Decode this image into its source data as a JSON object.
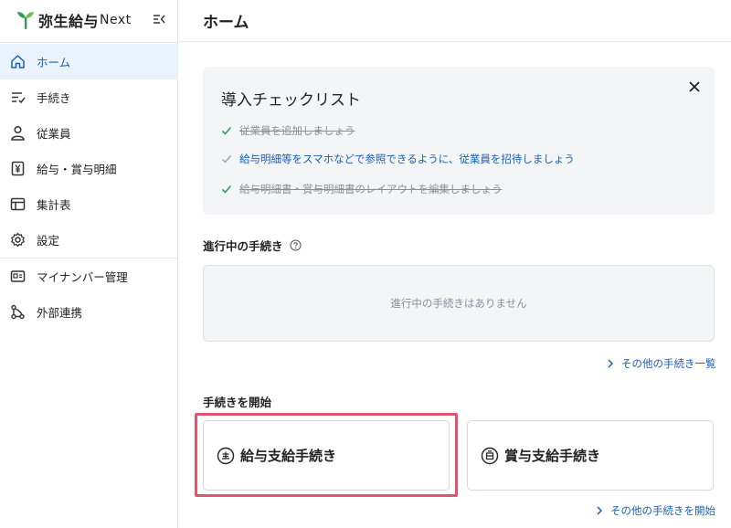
{
  "brand": {
    "name": "弥生給与",
    "suffix": "Next",
    "icon": "leaf-logo-icon"
  },
  "sidebar": {
    "items": [
      {
        "label": "ホーム",
        "icon": "home-icon",
        "active": true
      },
      {
        "label": "手続き",
        "icon": "checklist-icon",
        "active": false
      },
      {
        "label": "従業員",
        "icon": "person-icon",
        "active": false
      },
      {
        "label": "給与・賞与明細",
        "icon": "yen-document-icon",
        "active": false
      },
      {
        "label": "集計表",
        "icon": "table-icon",
        "active": false
      },
      {
        "label": "設定",
        "icon": "gear-icon",
        "active": false
      },
      {
        "label": "マイナンバー管理",
        "icon": "id-card-icon",
        "active": false
      },
      {
        "label": "外部連携",
        "icon": "link-nodes-icon",
        "active": false
      }
    ]
  },
  "header": {
    "title": "ホーム"
  },
  "checklist": {
    "title": "導入チェックリスト",
    "items": [
      {
        "text": "従業員を追加しましょう",
        "done": true
      },
      {
        "text": "給与明細等をスマホなどで参照できるように、従業員を招待しましょう",
        "done": false
      },
      {
        "text": "給与明細書・賞与明細書のレイアウトを編集しましょう",
        "done": true
      }
    ]
  },
  "in_progress": {
    "title": "進行中の手続き",
    "empty_text": "進行中の手続きはありません",
    "more_link": "その他の手続き一覧"
  },
  "start": {
    "title": "手続きを開始",
    "cards": [
      {
        "label": "給与支給手続き",
        "icon": "salary-badge-icon"
      },
      {
        "label": "賞与支給手続き",
        "icon": "bonus-badge-icon"
      }
    ],
    "more_link": "その他の手続きを開始"
  },
  "colors": {
    "accent": "#1a5fb4",
    "active_bg": "#eaf2fb",
    "highlight": "#e0566e",
    "check": "#2e9e5b"
  }
}
